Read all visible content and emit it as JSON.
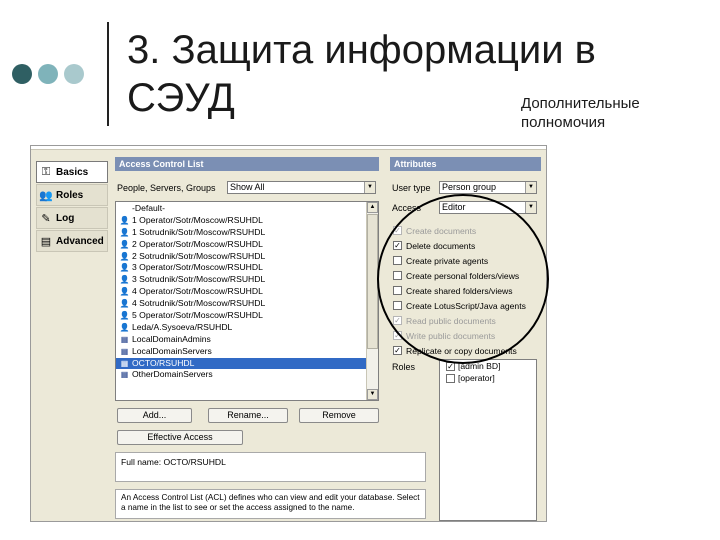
{
  "slide": {
    "title_line1": "3. Защита информации в",
    "title_line2": "СЭУД",
    "note_line1": "Дополнительные",
    "note_line2": "полномочия"
  },
  "sidebar": {
    "items": [
      {
        "label": "Basics",
        "icon": "key-icon"
      },
      {
        "label": "Roles",
        "icon": "people-icon"
      },
      {
        "label": "Log",
        "icon": "log-icon"
      },
      {
        "label": "Advanced",
        "icon": "advanced-icon"
      }
    ]
  },
  "acl": {
    "header": "Access Control List",
    "filter_label": "People, Servers, Groups",
    "filter_value": "Show All",
    "entries": [
      "-Default-",
      "1 Operator/Sotr/Moscow/RSUHDL",
      "1 Sotrudnik/Sotr/Moscow/RSUHDL",
      "2 Operator/Sotr/Moscow/RSUHDL",
      "2 Sotrudnik/Sotr/Moscow/RSUHDL",
      "3 Operator/Sotr/Moscow/RSUHDL",
      "3 Sotrudnik/Sotr/Moscow/RSUHDL",
      "4 Operator/Sotr/Moscow/RSUHDL",
      "4 Sotrudnik/Sotr/Moscow/RSUHDL",
      "5 Operator/Sotr/Moscow/RSUHDL",
      "Leda/A.Sysoeva/RSUHDL",
      "LocalDomainAdmins",
      "LocalDomainServers",
      "OCTO/RSUHDL",
      "OtherDomainServers"
    ],
    "selected_index": 13,
    "add_label": "Add...",
    "rename_label": "Rename...",
    "remove_label": "Remove",
    "effective_label": "Effective Access",
    "fullname_text": "Full name: OCTO/RSUHDL",
    "description": "An Access Control List (ACL) defines who can view and edit your database. Select a name in the list to see or set the access assigned to the name."
  },
  "attributes": {
    "header": "Attributes",
    "user_type_label": "User type",
    "user_type_value": "Person group",
    "access_label": "Access",
    "access_value": "Editor",
    "permissions": [
      {
        "label": "Create documents",
        "checked": true,
        "disabled": true
      },
      {
        "label": "Delete documents",
        "checked": true,
        "disabled": false
      },
      {
        "label": "Create private agents",
        "checked": false,
        "disabled": false
      },
      {
        "label": "Create personal folders/views",
        "checked": false,
        "disabled": false
      },
      {
        "label": "Create shared folders/views",
        "checked": false,
        "disabled": false
      },
      {
        "label": "Create LotusScript/Java agents",
        "checked": false,
        "disabled": false
      },
      {
        "label": "Read public documents",
        "checked": true,
        "disabled": true
      },
      {
        "label": "Write public documents",
        "checked": true,
        "disabled": true
      },
      {
        "label": "Replicate or copy documents",
        "checked": true,
        "disabled": false
      }
    ],
    "roles_label": "Roles",
    "roles": [
      {
        "label": "[admin BD]",
        "checked": true
      },
      {
        "label": "[operator]",
        "checked": false
      }
    ]
  }
}
